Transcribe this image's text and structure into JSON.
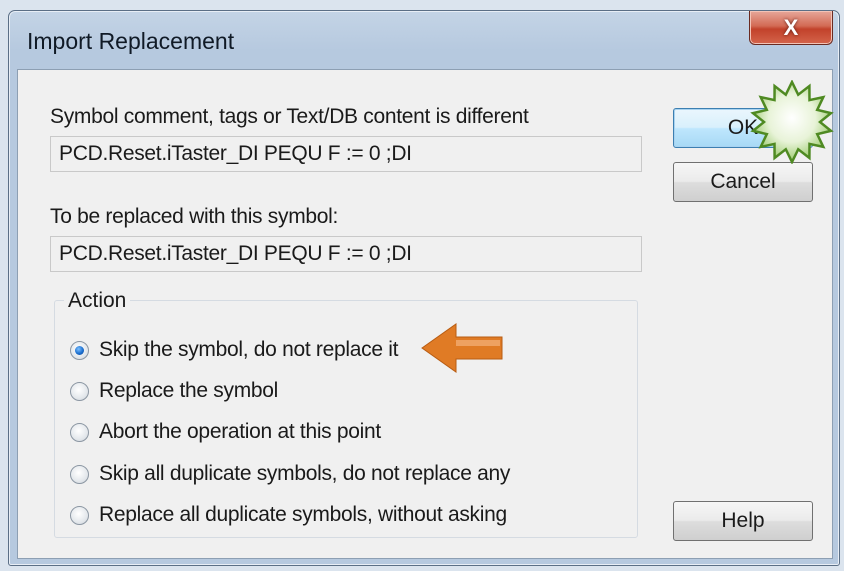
{
  "window": {
    "title": "Import Replacement",
    "close_label": "X"
  },
  "content": {
    "diff_label": "Symbol comment, tags or Text/DB content is different",
    "diff_value": "PCD.Reset.iTaster_DI PEQU F := 0 ;DI",
    "replace_label": "To be replaced with this symbol:",
    "replace_value": "PCD.Reset.iTaster_DI PEQU F := 0 ;DI"
  },
  "action": {
    "legend": "Action",
    "options": [
      {
        "label": "Skip the symbol, do not replace it",
        "checked": true
      },
      {
        "label": "Replace the symbol",
        "checked": false
      },
      {
        "label": "Abort the operation at this point",
        "checked": false
      },
      {
        "label": "Skip all duplicate symbols, do not replace any",
        "checked": false
      },
      {
        "label": "Replace all duplicate symbols, without asking",
        "checked": false
      }
    ]
  },
  "buttons": {
    "ok": "OK",
    "cancel": "Cancel",
    "help": "Help"
  },
  "annotations": {
    "arrow_color": "#e07b25",
    "starburst_color": "#5fa02c"
  }
}
